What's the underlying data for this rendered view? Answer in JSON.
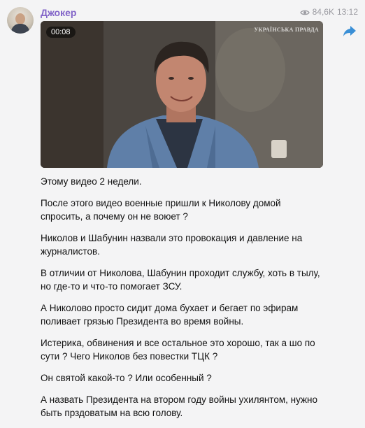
{
  "post": {
    "channel_name": "Джокер",
    "views": "84,6K",
    "time": "13:12",
    "video": {
      "duration": "00:08",
      "watermark": "УКРАЇНСЬКА ПРАВДА"
    },
    "paragraphs": [
      "Этому видео 2 недели.",
      "После этого видео военные пришли к Николову домой спросить, а почему он не воюет ?",
      "Николов и Шабунин назвали это провокация и давление на журналистов.",
      "В отличии от Николова, Шабунин проходит службу, хоть в тылу, но где-то и что-то помогает ЗСУ.",
      "А Николово просто сидит дома бухает и бегает по эфирам поливает грязью Президента во время войны.",
      "Истерика, обвинения и все остальное это хорошо, так а шо по сути ? Чего Николов без повестки ТЦК ?",
      "Он святой какой-то ? Или особенный ?",
      "А назвать Президента на втором году войны ухилянтом, нужно быть прздоватым на всю голову."
    ]
  },
  "icons": {
    "eye": "eye-icon",
    "share": "share-arrow-icon"
  },
  "colors": {
    "channel_name": "#8264c8",
    "share_icon": "#3a8fd6",
    "meta_text": "#9a9aa0"
  }
}
